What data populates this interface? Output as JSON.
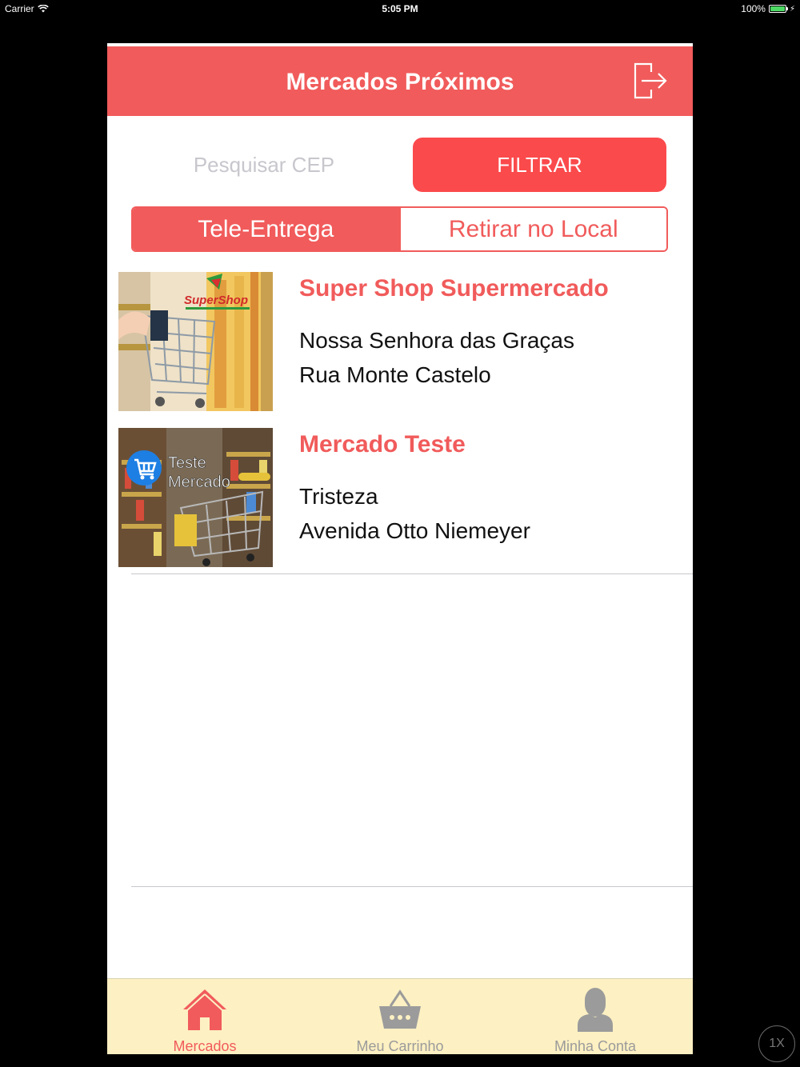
{
  "status_bar": {
    "carrier": "Carrier",
    "time": "5:05 PM",
    "battery": "100%"
  },
  "nav": {
    "title": "Mercados Próximos",
    "logout_icon": "logout-arrow-icon"
  },
  "search": {
    "placeholder": "Pesquisar CEP",
    "value": "",
    "filter_label": "FILTRAR"
  },
  "delivery_mode": {
    "options": [
      "Tele-Entrega",
      "Retirar no Local"
    ],
    "selected": "Tele-Entrega"
  },
  "markets": [
    {
      "name": "Super Shop Supermercado",
      "neighborhood": "Nossa Senhora das Graças",
      "street": "Rua Monte Castelo",
      "logo_text": "SuperShop"
    },
    {
      "name": "Mercado Teste",
      "neighborhood": "Tristeza",
      "street": "Avenida Otto Niemeyer",
      "logo_text_1": "Teste",
      "logo_text_2": "Mercado"
    }
  ],
  "tabs": [
    {
      "label": "Mercados",
      "icon": "home-icon",
      "active": true
    },
    {
      "label": "Meu Carrinho",
      "icon": "basket-icon",
      "active": false
    },
    {
      "label": "Minha Conta",
      "icon": "user-icon",
      "active": false
    }
  ],
  "zoom": "1X",
  "colors": {
    "brand": "#f15b5b",
    "button": "#fb4a4c",
    "tabbar": "#fdf0c2",
    "inactive": "#9b9b9b"
  }
}
